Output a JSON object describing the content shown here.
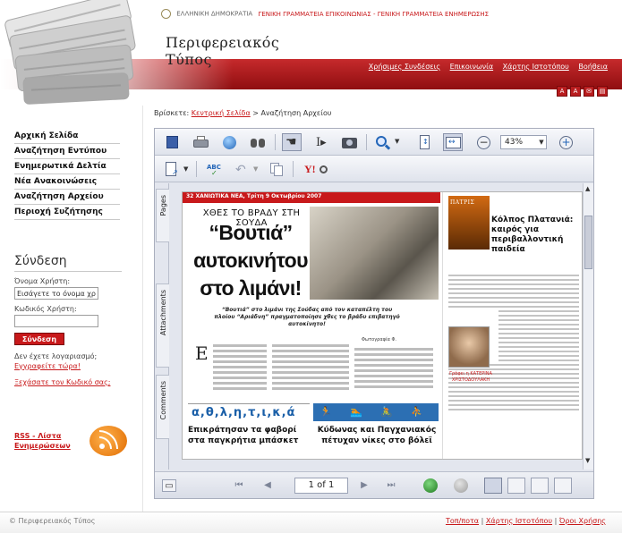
{
  "header": {
    "state": "ΕΛΛΗΝΙΚΗ ΔΗΜΟΚΡΑΤΙΑ",
    "agency": "ΓΕΝΙΚΗ ΓΡΑΜΜΑΤΕΙΑ ΕΠΙΚΟΙΝΩΝΙΑΣ - ΓΕΝΙΚΗ ΓΡΑΜΜΑΤΕΙΑ ΕΝΗΜΕΡΩΣΗΣ",
    "title_line1": "Περιφερειακός",
    "title_line2": "Τύπος",
    "links": [
      "Χρήσιμες Συνδέσεις",
      "Επικοινωνία",
      "Χάρτης Ιστοτόπου",
      "Βοήθεια"
    ],
    "tool_icons": [
      "text-size-icon",
      "text-larger-icon",
      "mail-icon",
      "print-icon"
    ],
    "accent_color": "#c8191b"
  },
  "sidebar": {
    "nav": [
      "Αρχική Σελίδα",
      "Αναζήτηση Εντύπου",
      "Ενημερωτικά Δελτία",
      "Νέα Ανακοινώσεις",
      "Αναζήτηση Αρχείου",
      "Περιοχή Συζήτησης"
    ],
    "login": {
      "title": "Σύνδεση",
      "username_label": "Όνομα Χρήστη:",
      "username_value": "Εισάγετε το όνομα χρ",
      "password_label": "Κωδικός Χρήστη:",
      "password_value": "",
      "button": "Σύνδεση",
      "no_account": "Δεν έχετε λογαριασμό;",
      "register": "Εγγραφείτε τώρα!",
      "forgot": "Ξεχάσατε τον Κωδικό σας;"
    },
    "rss": {
      "label": "RSS - Λίστα Ενημερώσεων",
      "icon": "rss-feed-icon"
    }
  },
  "breadcrumb": {
    "prefix": "Βρίσκετε:",
    "home": "Κεντρική Σελίδα",
    "current": "> Αναζήτηση Αρχείου"
  },
  "viewer": {
    "zoom": "43%",
    "side_tabs": [
      "Pages",
      "Attachments",
      "Comments"
    ],
    "page_indicator": "1 of 1",
    "document": {
      "strip": "32  ΧΑΝΙΩΤΙΚΑ ΝΕΑ, Τρίτη 9 Οκτωβρίου 2007",
      "kicker": "ΧΘΕΣ ΤΟ ΒΡΑΔΥ ΣΤΗ ΣΟΥΔΑ",
      "headline": "“Βουτιά” αυτοκινήτου στο λιμάνι!",
      "deck": "“Βουτιά” στο λιμάνι της Σούδας από τον καταπέλτη του πλοίου “Αριάδνη” πραγματοποίησε χθες το βράδυ επιβατηγό αυτοκίνητο!",
      "caption": "Φωτογραφία Φ.",
      "athletics": "α,θ,λ,η,τ,ι,κ,ά",
      "bottom_left": "Επικράτησαν τα φαβορί στα παγκρήτια μπάσκετ",
      "bottom_right": "Κύδωνας και Παγχανιακός πέτυχαν νίκες στο βόλεϊ",
      "patris": "ΠΑΤΡΙΣ",
      "right_headline": "Κόλπος Πλατανιά: καιρός για περιβαλλοντική παιδεία",
      "byline": "Γράφει η ΚΑΤΕΡΙΝΑ ΧΡΙΣΤΟΔΟΥΛΑΚΗ"
    }
  },
  "footer": {
    "copyright": "© Περιφερειακός Τύπος",
    "links": [
      "Τοπ/ποτα",
      "Χάρτης Ιστοτόπου",
      "Όροι Χρήσης"
    ]
  }
}
